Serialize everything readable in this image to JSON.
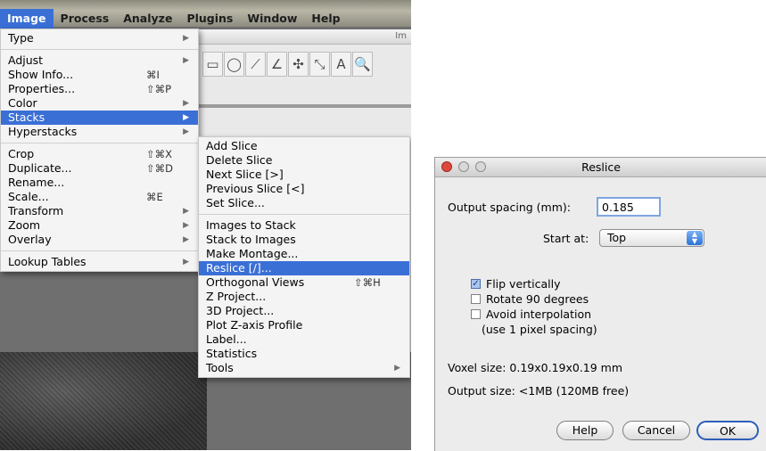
{
  "menubar": {
    "items": [
      "Image",
      "Process",
      "Analyze",
      "Plugins",
      "Window",
      "Help"
    ],
    "active_index": 0
  },
  "imagej_window": {
    "title_fragment": "Im",
    "tools": [
      "rectangle-icon",
      "oval-icon",
      "line-icon",
      "angle-icon",
      "point-icon",
      "wand-icon",
      "text-icon",
      "magnifier-icon"
    ],
    "tool_glyphs": [
      "▭",
      "◯",
      "⟋",
      "∠",
      "✣",
      "⤡",
      "A",
      "🔍"
    ]
  },
  "image_menu": {
    "items": [
      {
        "label": "Type",
        "submenu": true
      },
      {
        "separator": true
      },
      {
        "label": "Adjust",
        "submenu": true
      },
      {
        "label": "Show Info...",
        "shortcut": "⌘I"
      },
      {
        "label": "Properties...",
        "shortcut": "⇧⌘P"
      },
      {
        "label": "Color",
        "submenu": true
      },
      {
        "label": "Stacks",
        "submenu": true,
        "highlighted": true
      },
      {
        "label": "Hyperstacks",
        "submenu": true
      },
      {
        "separator": true
      },
      {
        "label": "Crop",
        "shortcut": "⇧⌘X"
      },
      {
        "label": "Duplicate...",
        "shortcut": "⇧⌘D"
      },
      {
        "label": "Rename..."
      },
      {
        "label": "Scale...",
        "shortcut": "⌘E"
      },
      {
        "label": "Transform",
        "submenu": true
      },
      {
        "label": "Zoom",
        "submenu": true
      },
      {
        "label": "Overlay",
        "submenu": true
      },
      {
        "separator": true
      },
      {
        "label": "Lookup Tables",
        "submenu": true
      }
    ]
  },
  "stacks_menu": {
    "items": [
      {
        "label": "Add Slice"
      },
      {
        "label": "Delete Slice"
      },
      {
        "label": "Next Slice [>]"
      },
      {
        "label": "Previous Slice [<]"
      },
      {
        "label": "Set Slice..."
      },
      {
        "separator": true
      },
      {
        "label": "Images to Stack"
      },
      {
        "label": "Stack to Images"
      },
      {
        "label": "Make Montage..."
      },
      {
        "label": "Reslice [/]...",
        "highlighted": true
      },
      {
        "label": "Orthogonal Views",
        "shortcut": "⇧⌘H"
      },
      {
        "label": "Z Project..."
      },
      {
        "label": "3D Project..."
      },
      {
        "label": "Plot Z-axis Profile"
      },
      {
        "label": "Label..."
      },
      {
        "label": "Statistics"
      },
      {
        "label": "Tools",
        "submenu": true
      }
    ]
  },
  "reslice_dialog": {
    "title": "Reslice",
    "output_spacing_label": "Output spacing (mm):",
    "output_spacing_value": "0.185",
    "start_at_label": "Start at:",
    "start_at_value": "Top",
    "flip_vertically_label": "Flip vertically",
    "flip_vertically_checked": true,
    "rotate_label": "Rotate 90 degrees",
    "rotate_checked": false,
    "avoid_interp_label": "Avoid interpolation",
    "avoid_interp_checked": false,
    "avoid_interp_note": "(use 1 pixel spacing)",
    "voxel_size": "Voxel size: 0.19x0.19x0.19 mm",
    "output_size": "Output size: <1MB (120MB free)",
    "help_label": "Help",
    "cancel_label": "Cancel",
    "ok_label": "OK"
  }
}
